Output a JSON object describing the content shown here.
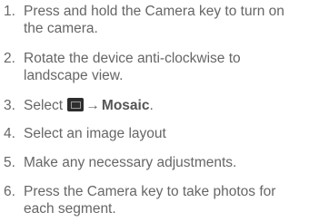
{
  "steps": [
    {
      "number": "1.",
      "lines": [
        "Press and hold the Camera key to turn on",
        "the camera."
      ]
    },
    {
      "number": "2.",
      "lines": [
        "Rotate the device anti-clockwise to",
        "landscape view."
      ]
    },
    {
      "number": "3.",
      "select_label": "Select",
      "icon": "camera-mode-icon",
      "arrow": "→",
      "target": "Mosaic",
      "suffix": "."
    },
    {
      "number": "4.",
      "lines": [
        "Select an image layout"
      ]
    },
    {
      "number": "5.",
      "lines": [
        "Make any necessary adjustments."
      ]
    },
    {
      "number": "6.",
      "lines": [
        "Press the Camera key to take photos for",
        "each segment."
      ]
    }
  ]
}
